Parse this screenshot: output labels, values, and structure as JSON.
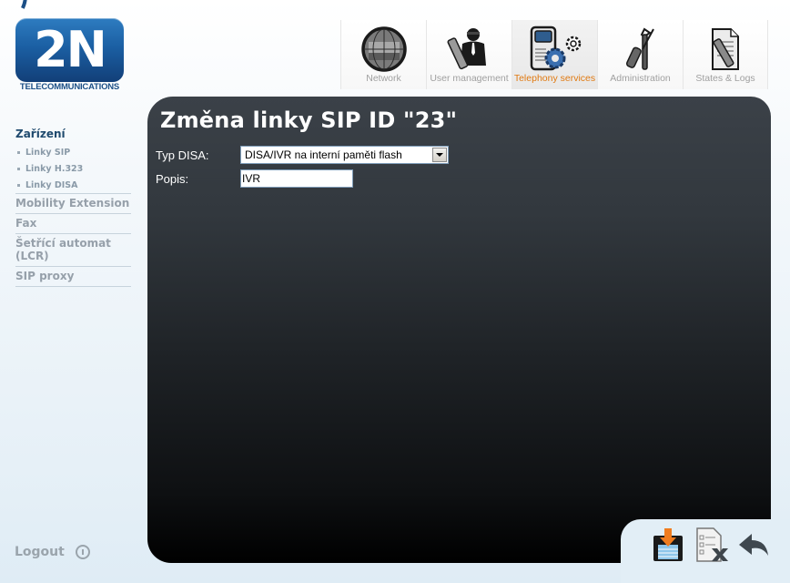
{
  "brand": {
    "logo_text": "2N",
    "logo_subtitle": "TELECOMMUNICATIONS"
  },
  "topnav": {
    "items": [
      {
        "label": "Network",
        "icon": "globe-icon",
        "active": false
      },
      {
        "label": "User management",
        "icon": "user-pencil-icon",
        "active": false
      },
      {
        "label": "Telephony services",
        "icon": "phone-gears-icon",
        "active": true
      },
      {
        "label": "Administration",
        "icon": "tools-icon",
        "active": false
      },
      {
        "label": "States & Logs",
        "icon": "document-pencil-icon",
        "active": false
      }
    ],
    "active_color": "#e07a12",
    "inactive_color": "#a0a0a0"
  },
  "sidebar": {
    "heading": "Zařízení",
    "subitems": [
      "Linky SIP",
      "Linky H.323",
      "Linky DISA"
    ],
    "items": [
      "Mobility Extension",
      "Fax",
      "Šetřící automat (LCR)",
      "SIP proxy"
    ]
  },
  "logout": {
    "label": "Logout",
    "icon": "power-icon"
  },
  "main": {
    "title": "Změna linky SIP ID \"23\"",
    "fields": {
      "typ_disa": {
        "label": "Typ DISA:",
        "value": "DISA/IVR na interní paměti flash"
      },
      "popis": {
        "label": "Popis:",
        "value": "IVR"
      }
    }
  },
  "actions": [
    {
      "name": "save",
      "icon": "save-icon"
    },
    {
      "name": "cancel",
      "icon": "discard-icon"
    },
    {
      "name": "back",
      "icon": "back-arrow-icon"
    }
  ]
}
